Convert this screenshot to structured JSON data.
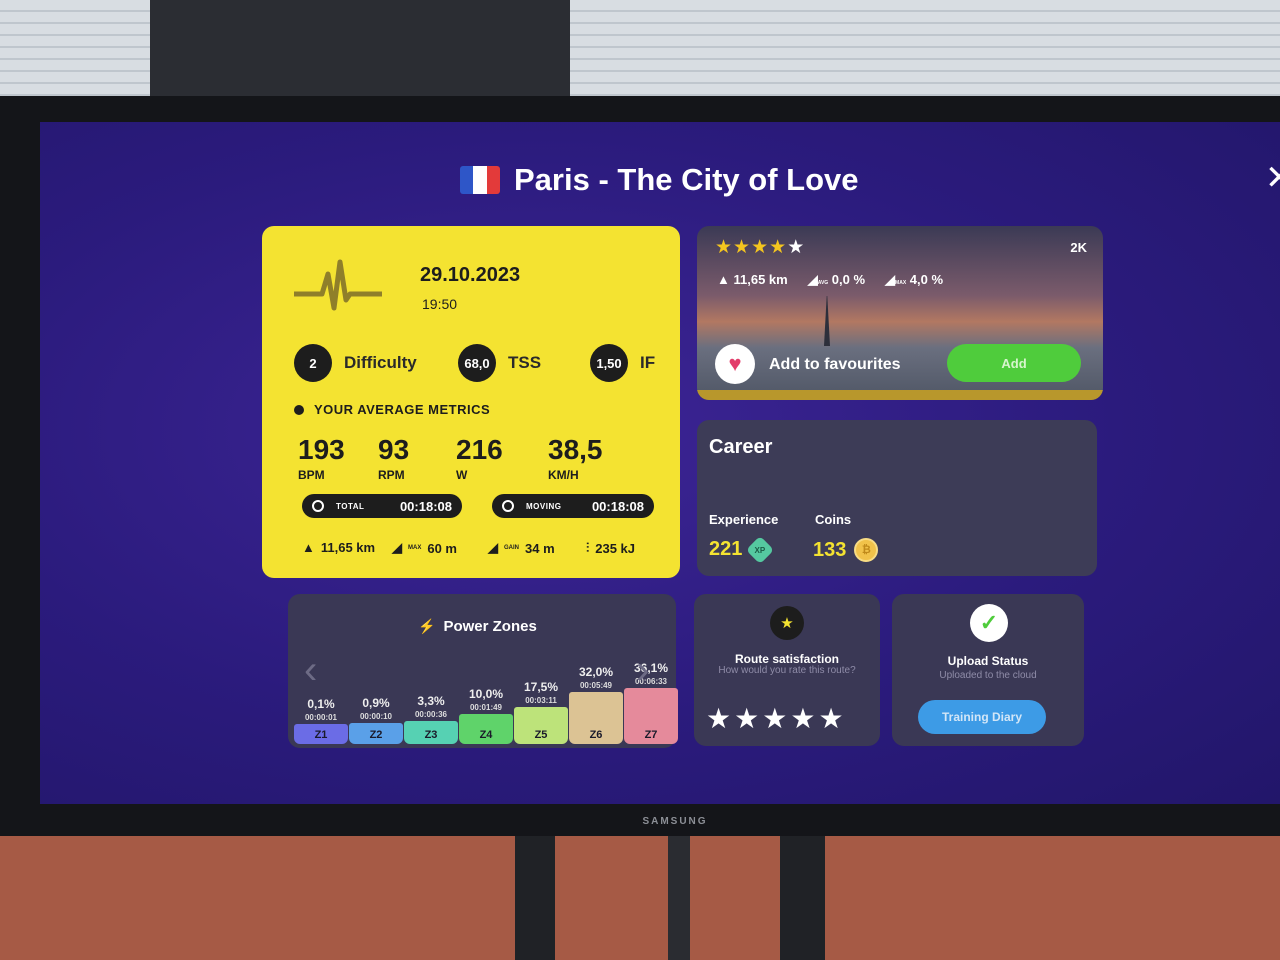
{
  "header": {
    "title": "Paris - The City of Love",
    "flag_colors": [
      "#2e56c8",
      "#ffffff",
      "#e33a3a"
    ]
  },
  "summary": {
    "date": "29.10.2023",
    "time": "19:50",
    "badges": [
      {
        "value": "2",
        "label": "Difficulty"
      },
      {
        "value": "68,0",
        "label": "TSS"
      },
      {
        "value": "1,50",
        "label": "IF"
      }
    ],
    "metrics_heading": "YOUR AVERAGE METRICS",
    "metrics": [
      {
        "value": "193",
        "unit": "BPM"
      },
      {
        "value": "93",
        "unit": "RPM"
      },
      {
        "value": "216",
        "unit": "W"
      },
      {
        "value": "38,5",
        "unit": "KM/H"
      }
    ],
    "total": {
      "label": "TOTAL",
      "value": "00:18:08"
    },
    "moving": {
      "label": "MOVING",
      "value": "00:18:08"
    },
    "stats": [
      {
        "icon": "distance-icon",
        "label": "",
        "value": "11,65 km"
      },
      {
        "icon": "max-elevation-icon",
        "label": "MAX",
        "value": "60 m"
      },
      {
        "icon": "elevation-gain-icon",
        "label": "GAIN",
        "value": "34 m"
      },
      {
        "icon": "energy-icon",
        "label": "",
        "value": "235 kJ"
      }
    ]
  },
  "route": {
    "rating": 4,
    "rating_max": 5,
    "resolution": "2K",
    "distance": "11,65 km",
    "avg_label": "AVG",
    "avg_grade": "0,0 %",
    "max_label": "MAX",
    "max_grade": "4,0 %",
    "favourite_label": "Add to favourites",
    "add_label": "Add"
  },
  "career": {
    "title": "Career",
    "experience_label": "Experience",
    "experience_value": "221",
    "xp_label": "XP",
    "coins_label": "Coins",
    "coins_value": "133"
  },
  "power_zones": {
    "title": "Power Zones",
    "zones": [
      {
        "name": "Z1",
        "percent": "0,1%",
        "duration": "00:00:01",
        "fraction": 0.001,
        "color": "#6b6ce6"
      },
      {
        "name": "Z2",
        "percent": "0,9%",
        "duration": "00:00:10",
        "fraction": 0.009,
        "color": "#5aa0e8"
      },
      {
        "name": "Z3",
        "percent": "3,3%",
        "duration": "00:00:36",
        "fraction": 0.033,
        "color": "#56d1b3"
      },
      {
        "name": "Z4",
        "percent": "10,0%",
        "duration": "00:01:49",
        "fraction": 0.1,
        "color": "#5fd36a"
      },
      {
        "name": "Z5",
        "percent": "17,5%",
        "duration": "00:03:11",
        "fraction": 0.175,
        "color": "#bde37a"
      },
      {
        "name": "Z6",
        "percent": "32,0%",
        "duration": "00:05:49",
        "fraction": 0.32,
        "color": "#dcc394"
      },
      {
        "name": "Z7",
        "percent": "36,1%",
        "duration": "00:06:33",
        "fraction": 0.361,
        "color": "#e58a9b"
      }
    ]
  },
  "satisfaction": {
    "title": "Route satisfaction",
    "subtitle": "How would you rate this route?",
    "stars": 5
  },
  "upload": {
    "title": "Upload Status",
    "subtitle": "Uploaded to the cloud",
    "button_label": "Training Diary"
  },
  "monitor_brand": "SAMSUNG"
}
